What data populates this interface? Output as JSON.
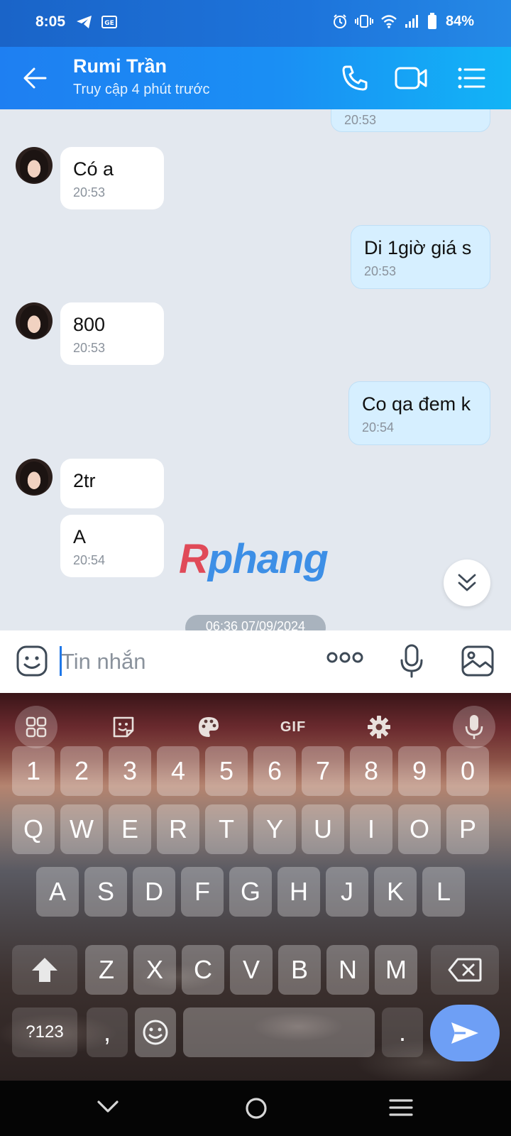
{
  "status_bar": {
    "time": "8:05",
    "battery_percent": "84%",
    "left_icons": [
      "telegram-icon",
      "ge-badge-icon"
    ],
    "right_icons": [
      "alarm-icon",
      "vibrate-icon",
      "wifi-icon",
      "signal-icon",
      "battery-icon"
    ]
  },
  "header": {
    "contact_name": "Rumi Trần",
    "status": "Truy cập 4 phút trước",
    "icons": [
      "back-arrow-icon",
      "phone-icon",
      "video-call-icon",
      "menu-list-icon"
    ],
    "accent": "#1e7ff2"
  },
  "messages": [
    {
      "dir": "out",
      "text": "",
      "time": "20:53"
    },
    {
      "dir": "in",
      "text": "Có a",
      "time": "20:53",
      "avatar": true
    },
    {
      "dir": "out",
      "text": "Di 1giờ giá s",
      "time": "20:53"
    },
    {
      "dir": "in",
      "text": "800",
      "time": "20:53",
      "avatar": true
    },
    {
      "dir": "out",
      "text": "Co qa đem k",
      "time": "20:54"
    },
    {
      "dir": "in",
      "text": "2tr",
      "time": "",
      "avatar": true
    },
    {
      "dir": "in",
      "text": "A",
      "time": "20:54"
    }
  ],
  "date_chip": "06:36 07/09/2024",
  "watermark": {
    "part1": "R",
    "part2": "phang"
  },
  "input": {
    "placeholder": "Tin nhắn",
    "icons": [
      "emoji-sticker-icon",
      "more-dots-icon",
      "microphone-icon",
      "image-icon"
    ]
  },
  "keyboard": {
    "toolbar": [
      "apps-grid-icon",
      "sticker-icon",
      "palette-icon",
      "GIF",
      "settings-gear-icon",
      "voice-mic-icon"
    ],
    "row_numbers": [
      "1",
      "2",
      "3",
      "4",
      "5",
      "6",
      "7",
      "8",
      "9",
      "0"
    ],
    "row1": [
      "Q",
      "W",
      "E",
      "R",
      "T",
      "Y",
      "U",
      "I",
      "O",
      "P"
    ],
    "row2": [
      "A",
      "S",
      "D",
      "F",
      "G",
      "H",
      "J",
      "K",
      "L"
    ],
    "row3": [
      "Z",
      "X",
      "C",
      "V",
      "B",
      "N",
      "M"
    ],
    "symbols_label": "?123",
    "comma": ",",
    "period": "."
  },
  "nav": [
    "back-chevron-icon",
    "home-circle-icon",
    "recents-icon"
  ]
}
